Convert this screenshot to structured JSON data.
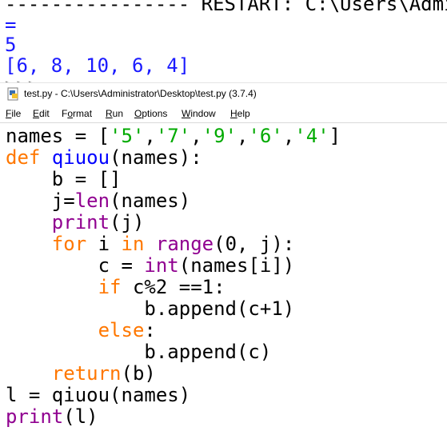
{
  "shell": {
    "restart_line": "---------------- RESTART: C:\\Users\\Administrator\\Desktop\\test.py ================",
    "equals_line": "=",
    "output_lines": [
      "5",
      "[6, 8, 10, 6, 4]"
    ],
    "prompt": ">>> "
  },
  "editor_window": {
    "title": "test.py - C:\\Users\\Administrator\\Desktop\\test.py (3.7.4)",
    "menu": [
      {
        "label": "File",
        "key": "F"
      },
      {
        "label": "Edit",
        "key": "E"
      },
      {
        "label": "Format",
        "key": "o"
      },
      {
        "label": "Run",
        "key": "R"
      },
      {
        "label": "Options",
        "key": "O"
      },
      {
        "label": "Window",
        "key": "W"
      },
      {
        "label": "Help",
        "key": "H"
      }
    ]
  },
  "code": {
    "line1": {
      "a": "names = [",
      "s1": "'5'",
      "c1": ",",
      "s2": "'7'",
      "c2": ",",
      "s3": "'9'",
      "c3": ",",
      "s4": "'6'",
      "c4": ",",
      "s5": "'4'",
      "e": "]"
    },
    "line2": {
      "kw": "def",
      "fn": "qiuou",
      "rest": "(names):"
    },
    "line3": "    b = []",
    "line4": {
      "a": "    j=",
      "bi": "len",
      "b": "(names)"
    },
    "line5": {
      "a": "    ",
      "bi": "print",
      "b": "(j)"
    },
    "line6": {
      "a": "    ",
      "kw1": "for",
      "b": " i ",
      "kw2": "in",
      "c": " ",
      "bi": "range",
      "d": "(0, j):"
    },
    "line7": {
      "a": "        c = ",
      "bi": "int",
      "b": "(names[i])"
    },
    "line8": {
      "a": "        ",
      "kw": "if",
      "b": " c%2 ==1:"
    },
    "line9": "            b.append(c+1)",
    "line10": {
      "a": "        ",
      "kw": "else",
      "b": ":"
    },
    "line11": "            b.append(c)",
    "line12": {
      "a": "    ",
      "kw": "return",
      "b": "(b)"
    },
    "line13": "l = qiuou(names)",
    "line14": {
      "bi": "print",
      "b": "(l)"
    }
  },
  "colors": {
    "keyword": "#ff7700",
    "builtin": "#900090",
    "string": "#00aa00",
    "def_name": "#0000ff",
    "shell_output": "#1a1aff"
  }
}
